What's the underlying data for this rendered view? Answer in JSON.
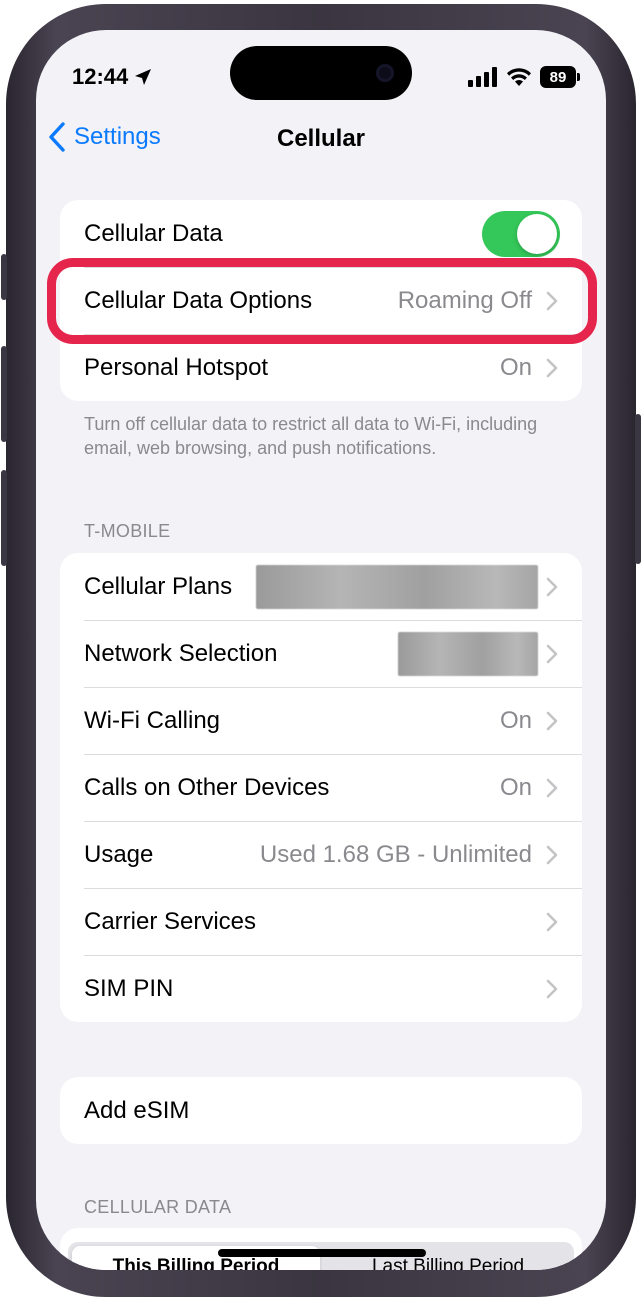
{
  "status_bar": {
    "time": "12:44",
    "battery": "89"
  },
  "nav": {
    "back_label": "Settings",
    "title": "Cellular"
  },
  "group1": {
    "cellular_data": {
      "label": "Cellular Data",
      "toggle_on": true
    },
    "cellular_data_options": {
      "label": "Cellular Data Options",
      "value": "Roaming Off"
    },
    "personal_hotspot": {
      "label": "Personal Hotspot",
      "value": "On"
    }
  },
  "group1_footer": "Turn off cellular data to restrict all data to Wi-Fi, including email, web browsing, and push notifications.",
  "tmobile_section": {
    "header": "T-MOBILE",
    "rows": [
      {
        "label": "Cellular Plans",
        "value": ""
      },
      {
        "label": "Network Selection",
        "value": ""
      },
      {
        "label": "Wi-Fi Calling",
        "value": "On"
      },
      {
        "label": "Calls on Other Devices",
        "value": "On"
      },
      {
        "label": "Usage",
        "value": "Used 1.68 GB - Unlimited"
      },
      {
        "label": "Carrier Services",
        "value": ""
      },
      {
        "label": "SIM PIN",
        "value": ""
      }
    ]
  },
  "esim": {
    "label": "Add eSIM"
  },
  "cellular_data_section": {
    "header": "CELLULAR DATA",
    "tabs": [
      "This Billing Period",
      "Last Billing Period"
    ]
  },
  "colors": {
    "accent": "#0a7aff",
    "toggle_on": "#34c759",
    "highlight": "#e5254b"
  }
}
